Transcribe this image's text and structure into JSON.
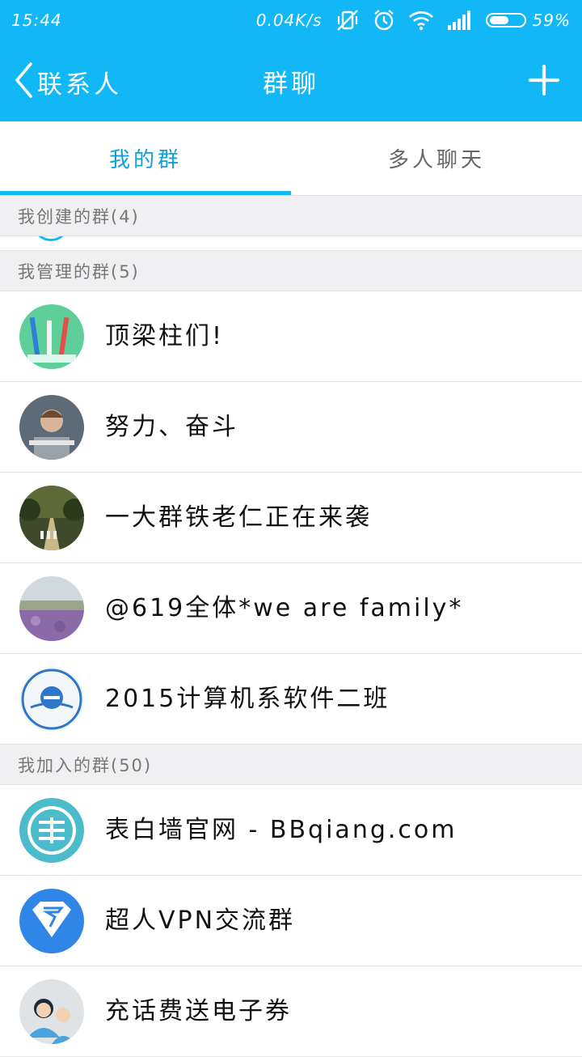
{
  "status_bar": {
    "time": "15:44",
    "speed": "0.04K/s",
    "battery": "59%",
    "battery_level": 0.59
  },
  "header": {
    "back_label": "联系人",
    "title": "群聊"
  },
  "tabs": [
    {
      "label": "我的群",
      "active": true
    },
    {
      "label": "多人聊天",
      "active": false
    }
  ],
  "sections": {
    "created": "我创建的群(4)",
    "managed": "我管理的群(5)",
    "joined": "我加入的群(50)"
  },
  "managed_groups": [
    {
      "name": "顶梁柱们!",
      "icon": "toothbrush-avatar"
    },
    {
      "name": "努力、奋斗",
      "icon": "boy-laptop-avatar"
    },
    {
      "name": "一大群铁老仁正在来袭",
      "icon": "tree-road-avatar"
    },
    {
      "name": "@619全体*we are family*",
      "icon": "lavender-field-avatar"
    },
    {
      "name": "2015计算机系软件二班",
      "icon": "ie-badge-avatar"
    }
  ],
  "joined_groups": [
    {
      "name": "表白墙官网 - BBqiang.com",
      "icon": "wall-character-avatar"
    },
    {
      "name": "超人VPN交流群",
      "icon": "superman-logo-avatar"
    },
    {
      "name": "充话费送电子券",
      "icon": "people-avatar"
    }
  ],
  "colors": {
    "brand": "#12b7f5",
    "active_tab_text": "#12a0d8",
    "section_bg": "#f0f0f2"
  }
}
